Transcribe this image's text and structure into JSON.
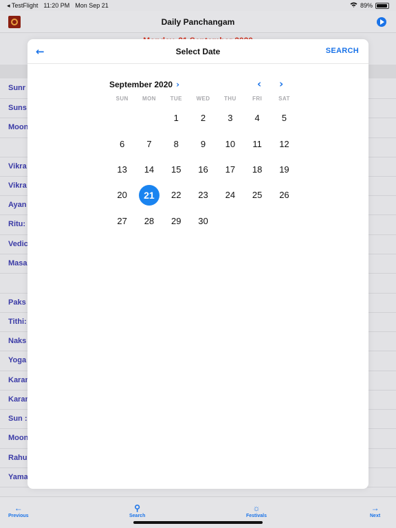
{
  "status_bar": {
    "carrier": "◂ TestFlight",
    "time": "11:20 PM",
    "date": "Mon Sep 21",
    "battery": "89%"
  },
  "nav": {
    "title": "Daily Panchangam"
  },
  "date_banner": "Monday, 21 September 2020",
  "background_rows": [
    "Sunr",
    "Suns",
    "Moon",
    "Vikra",
    "Vikra",
    "Ayan",
    "Ritu:",
    "Vedic",
    "Masa",
    "Paks",
    "Tithi:",
    "Naks",
    "Yoga",
    "Karan",
    "Karan",
    "Sun :",
    "Moon",
    "Rahu",
    "Yama"
  ],
  "modal": {
    "title": "Select Date",
    "search_label": "SEARCH",
    "back_icon": "←"
  },
  "calendar": {
    "month_label": "September 2020",
    "month_chevron": "›",
    "prev_icon": "‹",
    "next_icon": "›",
    "weekdays": [
      "SUN",
      "MON",
      "TUE",
      "WED",
      "THU",
      "FRI",
      "SAT"
    ],
    "first_weekday_index": 2,
    "days": [
      "1",
      "2",
      "3",
      "4",
      "5",
      "6",
      "7",
      "8",
      "9",
      "10",
      "11",
      "12",
      "13",
      "14",
      "15",
      "16",
      "17",
      "18",
      "19",
      "20",
      "21",
      "22",
      "23",
      "24",
      "25",
      "26",
      "27",
      "28",
      "29",
      "30"
    ],
    "selected_day": "21",
    "accent_color": "#1a84f0"
  },
  "toolbar": {
    "previous_label": "Previous",
    "search_label": "Search",
    "festivals_label": "Festivals",
    "next_label": "Next",
    "previous_icon": "←",
    "search_icon": "⚲",
    "festivals_icon": "☼",
    "next_icon": "→"
  }
}
